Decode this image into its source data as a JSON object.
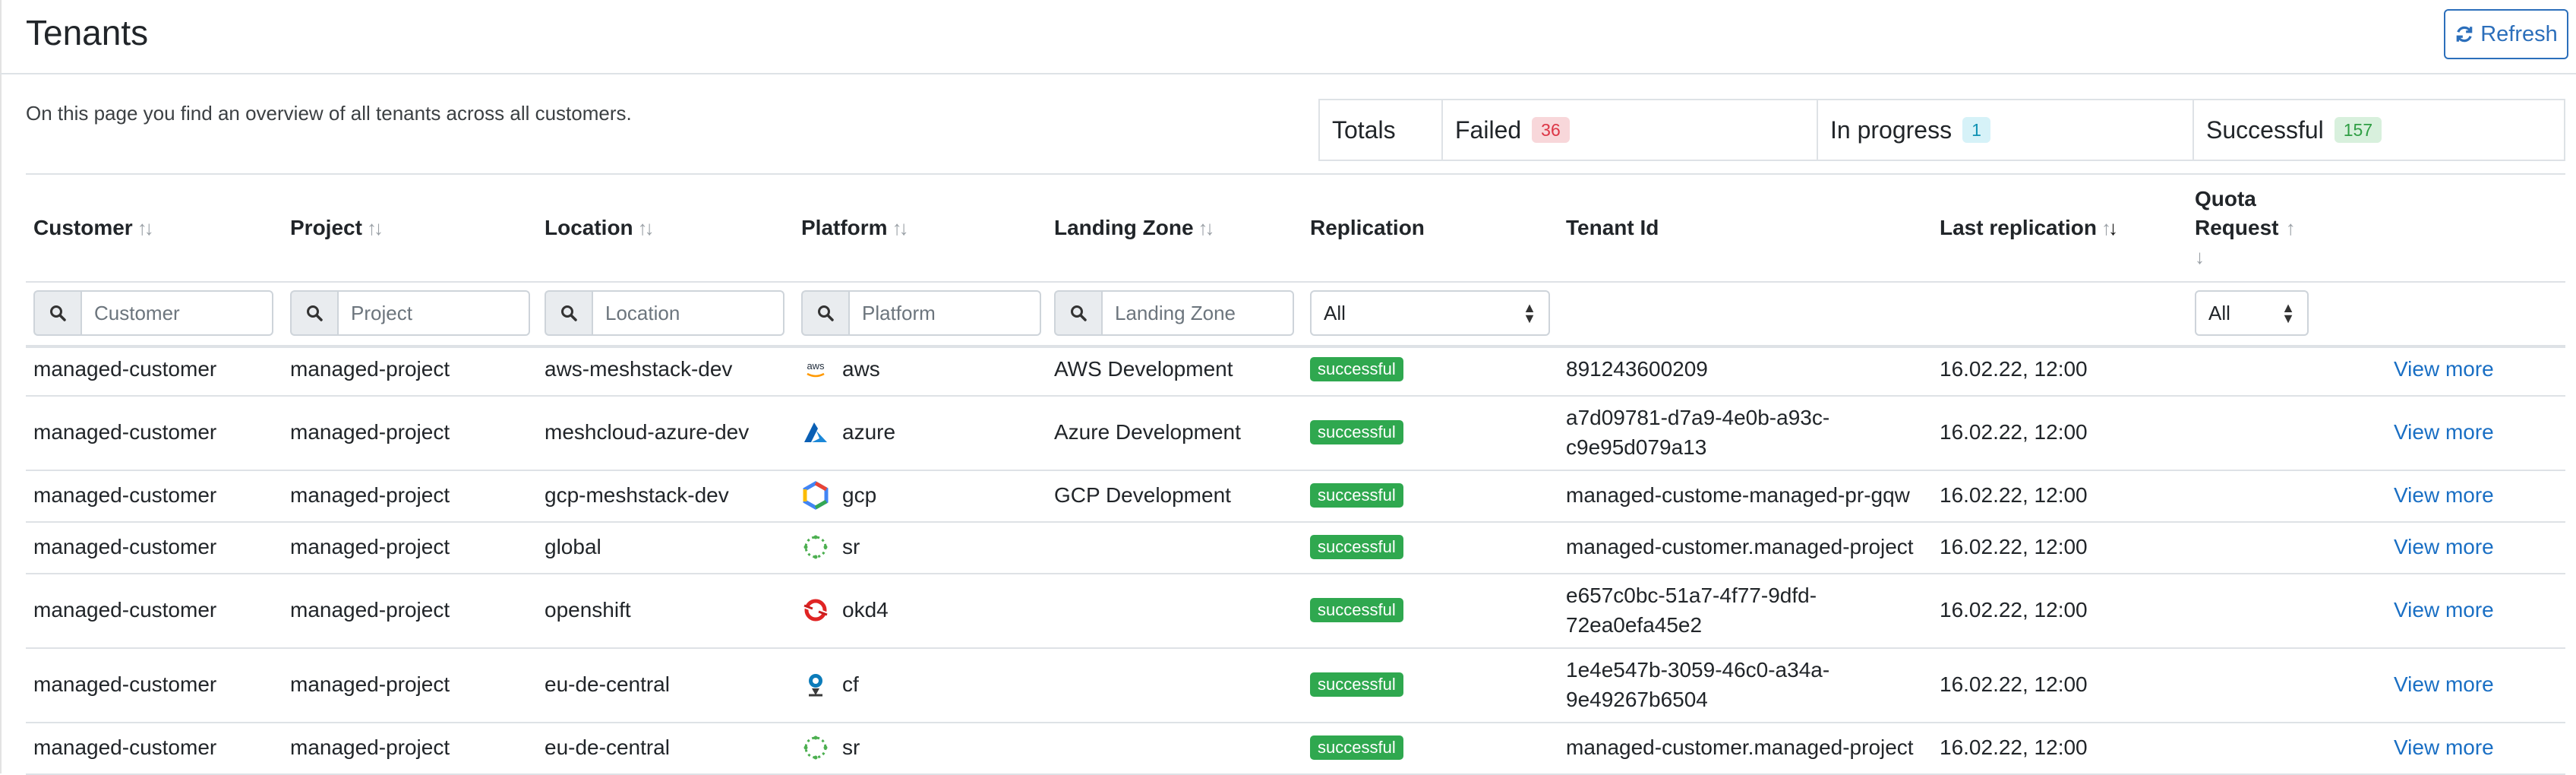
{
  "header": {
    "title": "Tenants",
    "refresh_label": "Refresh"
  },
  "intro": "On this page you find an overview of all tenants across all customers.",
  "totals": {
    "label": "Totals",
    "failed_label": "Failed",
    "failed_count": "36",
    "in_progress_label": "In progress",
    "in_progress_count": "1",
    "successful_label": "Successful",
    "successful_count": "157"
  },
  "columns": {
    "customer": "Customer",
    "project": "Project",
    "location": "Location",
    "platform": "Platform",
    "landing_zone": "Landing Zone",
    "replication": "Replication",
    "tenant_id": "Tenant Id",
    "last_replication": "Last replication",
    "quota_request_line1": "Quota",
    "quota_request_line2": "Request"
  },
  "filters": {
    "customer_placeholder": "Customer",
    "project_placeholder": "Project",
    "location_placeholder": "Location",
    "platform_placeholder": "Platform",
    "landing_zone_placeholder": "Landing Zone",
    "replication_value": "All",
    "quota_value": "All"
  },
  "rows": [
    {
      "customer": "managed-customer",
      "project": "managed-project",
      "location": "aws-meshstack-dev",
      "platform": "aws",
      "platform_icon": "aws-icon",
      "landing_zone": "AWS Development",
      "replication": "successful",
      "tenant_id_1": "891243600209",
      "tenant_id_2": "",
      "last_replication": "16.02.22, 12:00",
      "action": "View more"
    },
    {
      "customer": "managed-customer",
      "project": "managed-project",
      "location": "meshcloud-azure-dev",
      "platform": "azure",
      "platform_icon": "azure-icon",
      "landing_zone": "Azure Development",
      "replication": "successful",
      "tenant_id_1": "a7d09781-d7a9-4e0b-a93c-",
      "tenant_id_2": "c9e95d079a13",
      "last_replication": "16.02.22, 12:00",
      "action": "View more"
    },
    {
      "customer": "managed-customer",
      "project": "managed-project",
      "location": "gcp-meshstack-dev",
      "platform": "gcp",
      "platform_icon": "gcp-icon",
      "landing_zone": "GCP Development",
      "replication": "successful",
      "tenant_id_1": "managed-custome-managed-pr-gqw",
      "tenant_id_2": "",
      "last_replication": "16.02.22, 12:00",
      "action": "View more"
    },
    {
      "customer": "managed-customer",
      "project": "managed-project",
      "location": "global",
      "platform": "sr",
      "platform_icon": "service-registry-icon",
      "landing_zone": "",
      "replication": "successful",
      "tenant_id_1": "managed-customer.managed-project",
      "tenant_id_2": "",
      "last_replication": "16.02.22, 12:00",
      "action": "View more"
    },
    {
      "customer": "managed-customer",
      "project": "managed-project",
      "location": "openshift",
      "platform": "okd4",
      "platform_icon": "openshift-icon",
      "landing_zone": "",
      "replication": "successful",
      "tenant_id_1": "e657c0bc-51a7-4f77-9dfd-",
      "tenant_id_2": "72ea0efa45e2",
      "last_replication": "16.02.22, 12:00",
      "action": "View more"
    },
    {
      "customer": "managed-customer",
      "project": "managed-project",
      "location": "eu-de-central",
      "platform": "cf",
      "platform_icon": "cloud-foundry-icon",
      "landing_zone": "",
      "replication": "successful",
      "tenant_id_1": "1e4e547b-3059-46c0-a34a-",
      "tenant_id_2": "9e49267b6504",
      "last_replication": "16.02.22, 12:00",
      "action": "View more"
    },
    {
      "customer": "managed-customer",
      "project": "managed-project",
      "location": "eu-de-central",
      "platform": "sr",
      "platform_icon": "service-registry-icon",
      "landing_zone": "",
      "replication": "successful",
      "tenant_id_1": "managed-customer.managed-project",
      "tenant_id_2": "",
      "last_replication": "16.02.22, 12:00",
      "action": "View more"
    }
  ]
}
